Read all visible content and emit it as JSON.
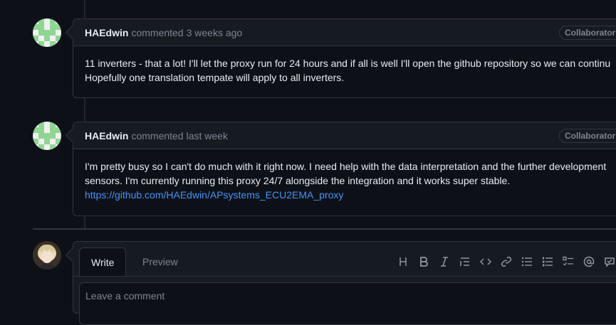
{
  "comments": [
    {
      "author": "HAEdwin",
      "action": "commented",
      "time": "3 weeks ago",
      "badge": "Collaborator",
      "lines": [
        "11 inverters - that a lot! I'll let the proxy run for 24 hours and if all is well I'll open the github repository so we can continu",
        "Hopefully one translation tempate will apply to all inverters."
      ]
    },
    {
      "author": "HAEdwin",
      "action": "commented",
      "time": "last week",
      "badge": "Collaborator",
      "lines": [
        "I'm pretty busy so I can't do much with it right now. I need help with the data interpretation and the further development",
        "sensors. I'm currently running this proxy 24/7 alongside the integration and it works super stable."
      ],
      "link": "https://github.com/HAEdwin/APsystems_ECU2EMA_proxy"
    }
  ],
  "composer": {
    "tabs": [
      "Write",
      "Preview"
    ],
    "placeholder": "Leave a comment",
    "toolbar_icons": [
      "heading-icon",
      "bold-icon",
      "italic-icon",
      "quote-icon",
      "code-icon",
      "link-icon",
      "bullet-list-icon",
      "numbered-list-icon",
      "task-list-icon",
      "mention-icon",
      "reference-icon"
    ]
  }
}
